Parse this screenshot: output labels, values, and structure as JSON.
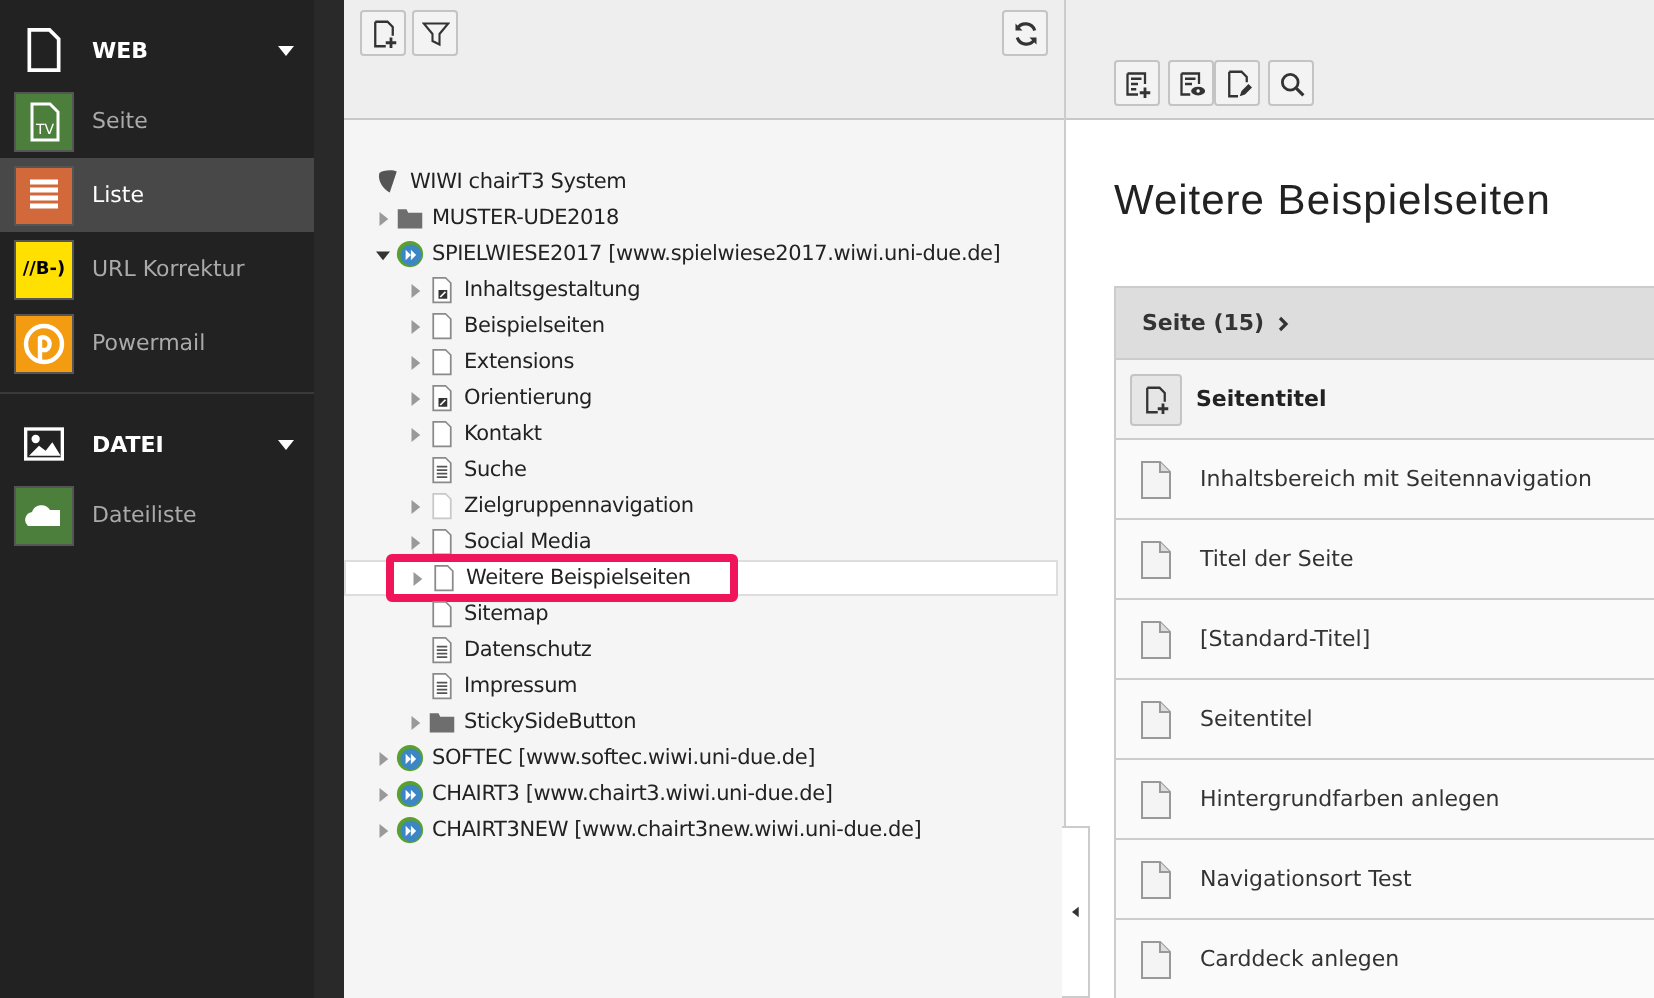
{
  "sidebar": {
    "groups": [
      {
        "title": "WEB",
        "kind": "page",
        "expanded": true,
        "modules": [
          {
            "label": "Seite",
            "kind": "tv",
            "icon_text": "TV",
            "color": "#4b7f3b",
            "selected": false
          },
          {
            "label": "Liste",
            "kind": "list",
            "color": "#d2693a",
            "selected": true
          },
          {
            "label": "URL Korrektur",
            "kind": "badge",
            "icon_text": "//B-)",
            "color": "#ffe000",
            "selected": false
          },
          {
            "label": "Powermail",
            "kind": "powermail",
            "color": "#f39c12",
            "selected": false
          }
        ]
      },
      {
        "title": "DATEI",
        "kind": "image",
        "expanded": true,
        "modules": [
          {
            "label": "Dateiliste",
            "kind": "cloud",
            "color": "#4b7f3b",
            "selected": false
          }
        ]
      }
    ]
  },
  "tree": {
    "root": {
      "label": "WIWI chairT3 System",
      "children": [
        {
          "label": "MUSTER-UDE2018",
          "kind": "folder",
          "expanded": false,
          "selected": false
        },
        {
          "label": "SPIELWIESE2017 [www.spielwiese2017.wiwi.uni-due.de]",
          "kind": "site",
          "expanded": true,
          "selected": false,
          "children": [
            {
              "label": "Inhaltsgestaltung",
              "kind": "shortcut",
              "expanded": false,
              "selected": false
            },
            {
              "label": "Beispielseiten",
              "kind": "page",
              "expanded": false,
              "selected": false
            },
            {
              "label": "Extensions",
              "kind": "page",
              "expanded": false,
              "selected": false
            },
            {
              "label": "Orientierung",
              "kind": "shortcut",
              "expanded": false,
              "selected": false
            },
            {
              "label": "Kontakt",
              "kind": "page",
              "expanded": false,
              "selected": false
            },
            {
              "label": "Suche",
              "kind": "doc",
              "selected": false
            },
            {
              "label": "Zielgruppennavigation",
              "kind": "hidden",
              "expanded": false,
              "selected": false
            },
            {
              "label": "Social Media",
              "kind": "page",
              "expanded": false,
              "selected": false
            },
            {
              "label": "Weitere Beispielseiten",
              "kind": "page",
              "expanded": false,
              "selected": true,
              "highlighted": true
            },
            {
              "label": "Sitemap",
              "kind": "page",
              "selected": false
            },
            {
              "label": "Datenschutz",
              "kind": "doc",
              "selected": false
            },
            {
              "label": "Impressum",
              "kind": "doc",
              "selected": false
            },
            {
              "label": "StickySideButton",
              "kind": "folder",
              "expanded": false,
              "selected": false
            }
          ]
        },
        {
          "label": "SOFTEC [www.softec.wiwi.uni-due.de]",
          "kind": "site",
          "expanded": false,
          "selected": false
        },
        {
          "label": "CHAIRT3 [www.chairt3.wiwi.uni-due.de]",
          "kind": "site",
          "expanded": false,
          "selected": false
        },
        {
          "label": "CHAIRT3NEW [www.chairt3new.wiwi.uni-due.de]",
          "kind": "site",
          "expanded": false,
          "selected": false
        }
      ]
    }
  },
  "content": {
    "title": "Weitere Beispielseiten",
    "table": {
      "heading": "Seite (15)",
      "column": "Seitentitel",
      "rows": [
        "Inhaltsbereich mit Seitennavigation",
        "Titel der Seite",
        "[Standard-Titel]",
        "Seitentitel",
        "Hintergrundfarben anlegen",
        "Navigationsort Test",
        "Carddeck anlegen"
      ]
    }
  }
}
